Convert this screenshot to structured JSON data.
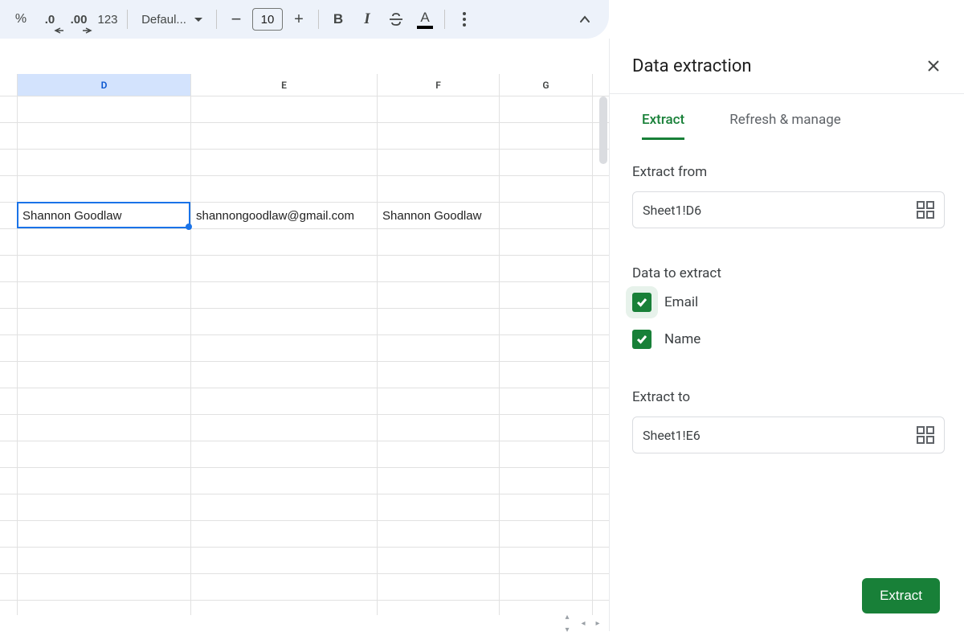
{
  "toolbar": {
    "percent": "%",
    "dec_left": ".0",
    "dec_right": ".00",
    "numfmt": "123",
    "font_name": "Defaul...",
    "font_size": "10",
    "bold": "B",
    "italic": "I",
    "text_color_letter": "A"
  },
  "sheet": {
    "column_headers": [
      "D",
      "E",
      "F",
      "G"
    ],
    "selected_column_index": 0,
    "rows": [
      {
        "D": "",
        "E": "",
        "F": "",
        "G": ""
      },
      {
        "D": "",
        "E": "",
        "F": "",
        "G": ""
      },
      {
        "D": "",
        "E": "",
        "F": "",
        "G": ""
      },
      {
        "D": "",
        "E": "",
        "F": "",
        "G": ""
      },
      {
        "D": "Shannon Goodlaw",
        "E": "shannongoodlaw@gmail.com",
        "F": "Shannon Goodlaw",
        "G": ""
      },
      {
        "D": "",
        "E": "",
        "F": "",
        "G": ""
      },
      {
        "D": "",
        "E": "",
        "F": "",
        "G": ""
      },
      {
        "D": "",
        "E": "",
        "F": "",
        "G": ""
      },
      {
        "D": "",
        "E": "",
        "F": "",
        "G": ""
      },
      {
        "D": "",
        "E": "",
        "F": "",
        "G": ""
      },
      {
        "D": "",
        "E": "",
        "F": "",
        "G": ""
      },
      {
        "D": "",
        "E": "",
        "F": "",
        "G": ""
      },
      {
        "D": "",
        "E": "",
        "F": "",
        "G": ""
      },
      {
        "D": "",
        "E": "",
        "F": "",
        "G": ""
      },
      {
        "D": "",
        "E": "",
        "F": "",
        "G": ""
      },
      {
        "D": "",
        "E": "",
        "F": "",
        "G": ""
      },
      {
        "D": "",
        "E": "",
        "F": "",
        "G": ""
      },
      {
        "D": "",
        "E": "",
        "F": "",
        "G": ""
      },
      {
        "D": "",
        "E": "",
        "F": "",
        "G": ""
      },
      {
        "D": "",
        "E": "",
        "F": "",
        "G": ""
      }
    ],
    "selected_row_index": 4
  },
  "panel": {
    "title": "Data extraction",
    "tabs": {
      "extract": "Extract",
      "refresh": "Refresh & manage"
    },
    "extract_from_label": "Extract from",
    "extract_from_value": "Sheet1!D6",
    "data_to_extract_label": "Data to extract",
    "check_email": "Email",
    "check_name": "Name",
    "extract_to_label": "Extract to",
    "extract_to_value": "Sheet1!E6",
    "extract_button": "Extract"
  }
}
